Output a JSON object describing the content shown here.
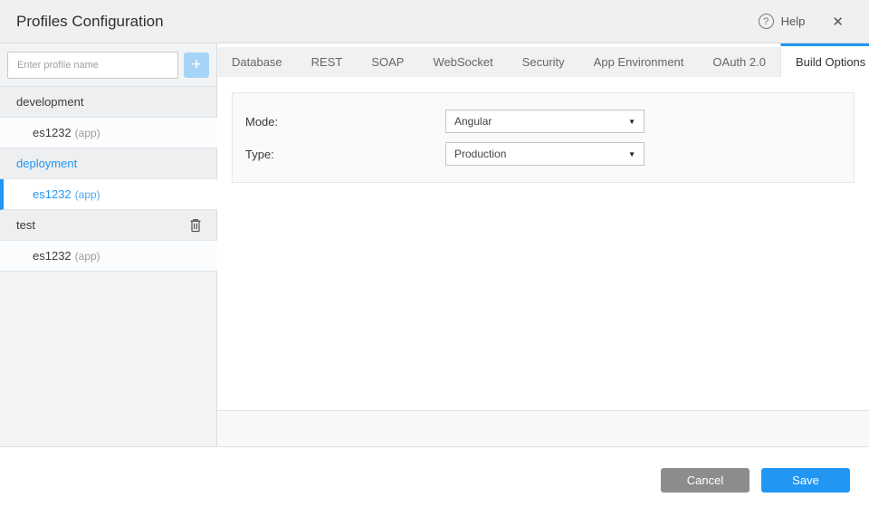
{
  "colors": {
    "accent": "#2196f3",
    "cancel_button": "#8c8c8c"
  },
  "header": {
    "title": "Profiles Configuration",
    "help_label": "Help",
    "help_icon_glyph": "?",
    "close_icon_glyph": "✕"
  },
  "sidebar": {
    "search": {
      "placeholder": "Enter profile name"
    },
    "add_button_glyph": "+",
    "rows": [
      {
        "label": "development",
        "type": "group",
        "selected": false
      },
      {
        "label": "es1232",
        "suffix": "(app)",
        "type": "app",
        "selected": false
      },
      {
        "label": "deployment",
        "type": "group",
        "selected": true
      },
      {
        "label": "es1232",
        "suffix": "(app)",
        "type": "app",
        "selected": true
      },
      {
        "label": "test",
        "type": "group",
        "selected": false,
        "has_delete": true
      },
      {
        "label": "es1232",
        "suffix": "(app)",
        "type": "app",
        "selected": false
      }
    ]
  },
  "main": {
    "tabs": [
      {
        "label": "Database",
        "active": false
      },
      {
        "label": "REST",
        "active": false
      },
      {
        "label": "SOAP",
        "active": false
      },
      {
        "label": "WebSocket",
        "active": false
      },
      {
        "label": "Security",
        "active": false
      },
      {
        "label": "App Environment",
        "active": false
      },
      {
        "label": "OAuth 2.0",
        "active": false
      },
      {
        "label": "Build Options",
        "active": true
      }
    ],
    "form": {
      "mode_label": "Mode:",
      "mode_value": "Angular",
      "type_label": "Type:",
      "type_value": "Production",
      "dropdown_arrow_glyph": "▼"
    }
  },
  "footer": {
    "cancel_label": "Cancel",
    "save_label": "Save"
  }
}
